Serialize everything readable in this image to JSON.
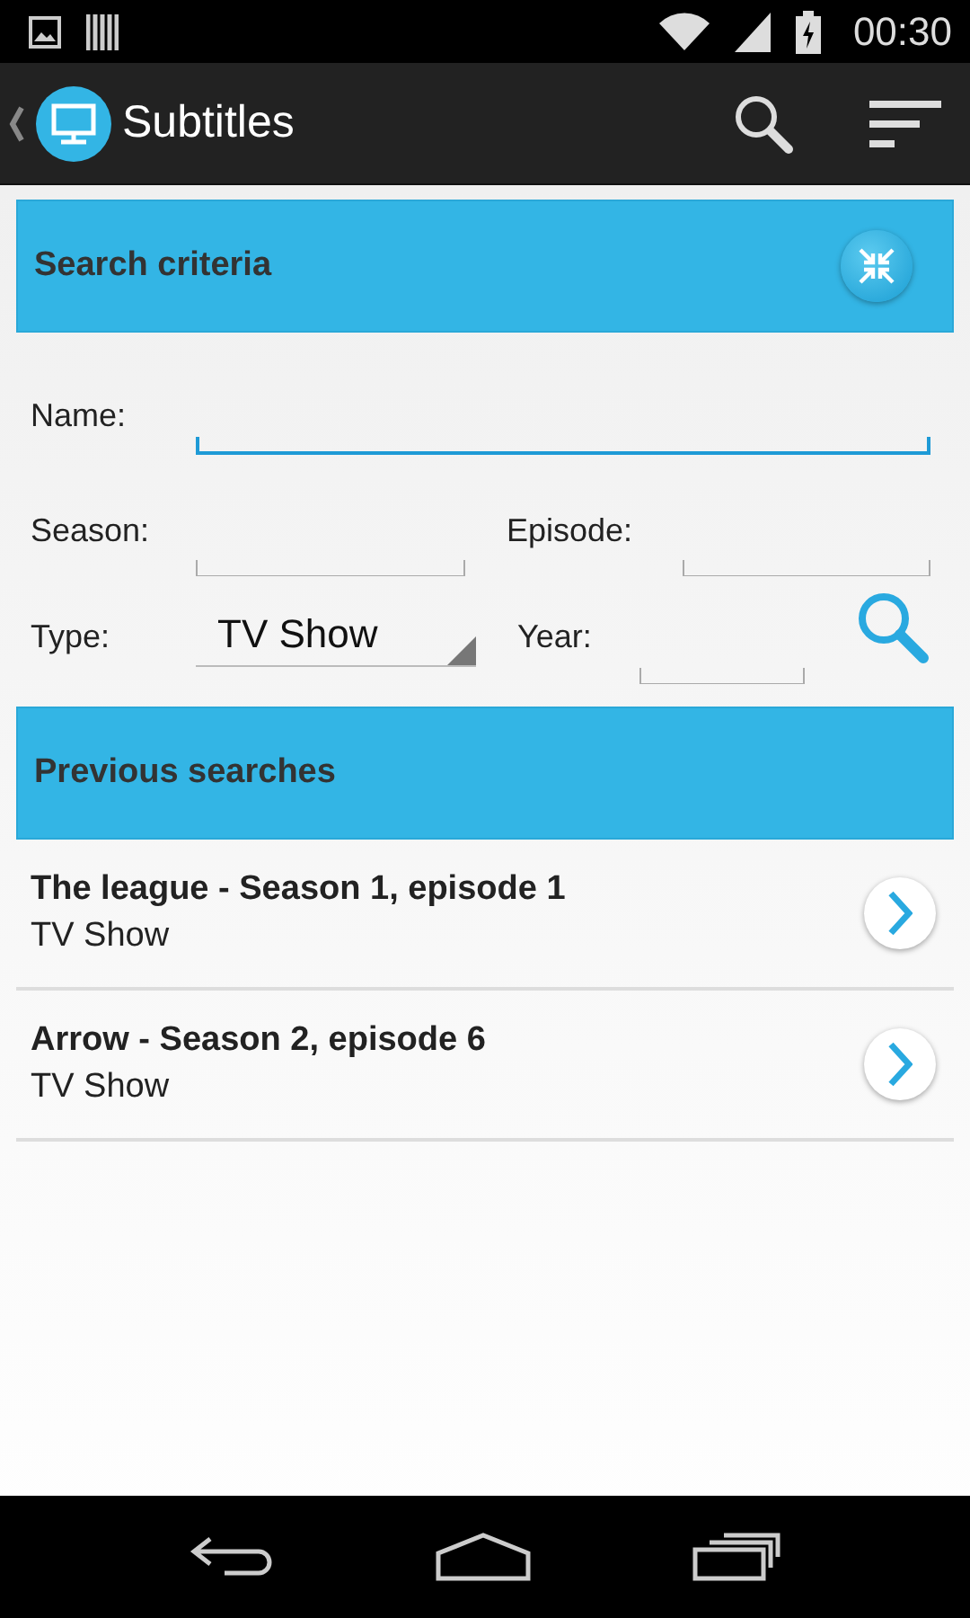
{
  "status_bar": {
    "time": "00:30"
  },
  "action_bar": {
    "title": "Subtitles"
  },
  "search_criteria": {
    "title": "Search criteria",
    "fields": [
      {
        "label": "Name:",
        "focused": true
      },
      {
        "label": "Season:",
        "focused": false
      },
      {
        "label": "Episode:",
        "focused": false
      }
    ],
    "type": {
      "label": "Type:",
      "value": "TV Show"
    },
    "year": {
      "label": "Year:",
      "focused": false
    }
  },
  "previous_searches": {
    "title": "Previous searches",
    "items": [
      {
        "title": "The league - Season 1, episode 1",
        "subtitle": "TV Show"
      },
      {
        "title": "Arrow - Season 2, episode 6",
        "subtitle": "TV Show"
      }
    ]
  }
}
